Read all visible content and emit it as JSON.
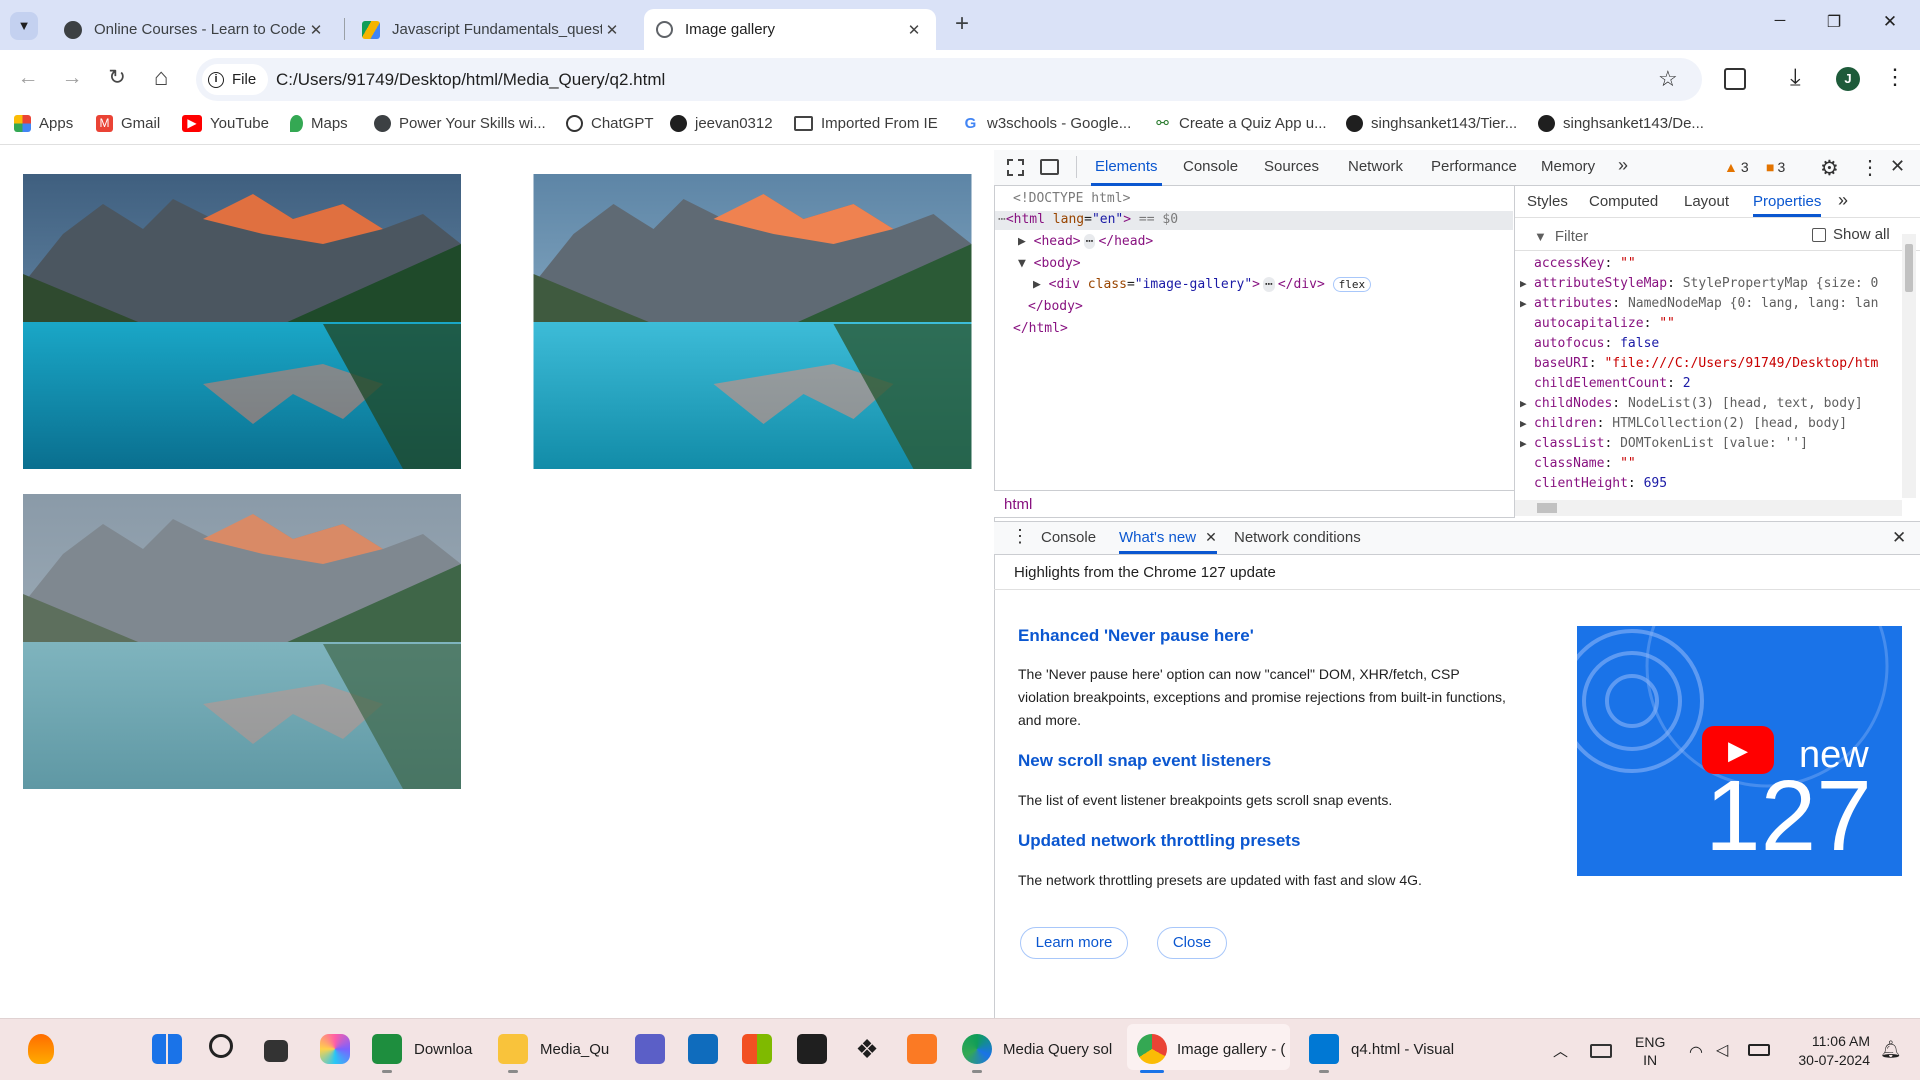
{
  "tabs": [
    {
      "title": "Online Courses - Learn to Code",
      "close": "✕"
    },
    {
      "title": "Javascript Fundamentals_questi",
      "close": "✕"
    },
    {
      "title": "Image gallery",
      "close": "✕"
    }
  ],
  "new_tab": "+",
  "window": {
    "minimize": "─",
    "maximize": "❐",
    "close": "✕"
  },
  "toolbar": {
    "back": "←",
    "forward": "→",
    "reload": "↻",
    "home": "⌂",
    "file_chip": "File",
    "url": "C:/Users/91749/Desktop/html/Media_Query/q2.html",
    "star": "☆",
    "profile": "J",
    "menu": "⋮",
    "download": "⤓"
  },
  "bookmarks": [
    "Apps",
    "Gmail",
    "YouTube",
    "Maps",
    "Power Your Skills wi...",
    "ChatGPT",
    "jeevan0312",
    "Imported From IE",
    "w3schools - Google...",
    "Create a Quiz App u...",
    "singhsanket143/Tier...",
    "singhsanket143/De..."
  ],
  "devtools": {
    "tabs": [
      "Elements",
      "Console",
      "Sources",
      "Network",
      "Performance",
      "Memory"
    ],
    "more": "»",
    "warnings": "3",
    "issues": "3",
    "elements": {
      "doctype": "<!DOCTYPE html>",
      "html_open": "<html",
      "html_attr": "lang",
      "html_val": "\"en\"",
      "html_close": ">",
      "selected_marker": "== $0",
      "head": "<head>",
      "head_end": "</head>",
      "body": "<body>",
      "div": "<div",
      "div_attr": "class",
      "div_val": "\"image-gallery\"",
      "div_end": "</div>",
      "flex_badge": "flex",
      "body_end": "</body>",
      "html_end": "</html>",
      "ellipsis": "⋯",
      "dots": "⋯"
    },
    "sub_tabs": [
      "Styles",
      "Computed",
      "Layout",
      "Properties"
    ],
    "filter_placeholder": "Filter",
    "show_all": "Show all",
    "properties": [
      {
        "key": "accessKey",
        "value": "\"\"",
        "type": "string",
        "expand": false
      },
      {
        "key": "attributeStyleMap",
        "value": "StylePropertyMap {size: 0",
        "type": "obj",
        "expand": true
      },
      {
        "key": "attributes",
        "value": "NamedNodeMap {0: lang, lang: lan",
        "type": "obj",
        "expand": true
      },
      {
        "key": "autocapitalize",
        "value": "\"\"",
        "type": "string",
        "expand": false
      },
      {
        "key": "autofocus",
        "value": "false",
        "type": "bool",
        "expand": false
      },
      {
        "key": "baseURI",
        "value": "\"file:///C:/Users/91749/Desktop/htm",
        "type": "string",
        "expand": false
      },
      {
        "key": "childElementCount",
        "value": "2",
        "type": "bool",
        "expand": false
      },
      {
        "key": "childNodes",
        "value": "NodeList(3) [head, text, body]",
        "type": "obj",
        "expand": true
      },
      {
        "key": "children",
        "value": "HTMLCollection(2) [head, body]",
        "type": "obj",
        "expand": true
      },
      {
        "key": "classList",
        "value": "DOMTokenList [value: '']",
        "type": "obj",
        "expand": true
      },
      {
        "key": "className",
        "value": "\"\"",
        "type": "string",
        "expand": false
      },
      {
        "key": "clientHeight",
        "value": "695",
        "type": "bool",
        "expand": false
      }
    ],
    "breadcrumb": "html",
    "drawer_tabs": [
      "Console",
      "What's new",
      "Network conditions"
    ],
    "whats_new": {
      "header": "Highlights from the Chrome 127 update",
      "sections": [
        {
          "title": "Enhanced 'Never pause here'",
          "body": "The 'Never pause here' option can now \"cancel\" DOM, XHR/fetch, CSP violation breakpoints, exceptions and promise rejections from built-in functions, and more."
        },
        {
          "title": "New scroll snap event listeners",
          "body": "The list of event listener breakpoints gets scroll snap events."
        },
        {
          "title": "Updated network throttling presets",
          "body": "The network throttling presets are updated with fast and slow 4G."
        }
      ],
      "learn_more": "Learn more",
      "close": "Close",
      "banner_new": "new",
      "banner_number": "127"
    }
  },
  "taskbar": {
    "items": [
      "Downloa",
      "Media_Qu",
      "Media Query sol",
      "Image gallery - (",
      "q4.html - Visual"
    ],
    "lang_top": "ENG",
    "lang_bottom": "IN",
    "time": "11:06 AM",
    "date": "30-07-2024"
  },
  "colors": {
    "accent": "#0b57d0",
    "tabstrip": "#dae2f7",
    "taskbar": "#f3e4e4"
  }
}
